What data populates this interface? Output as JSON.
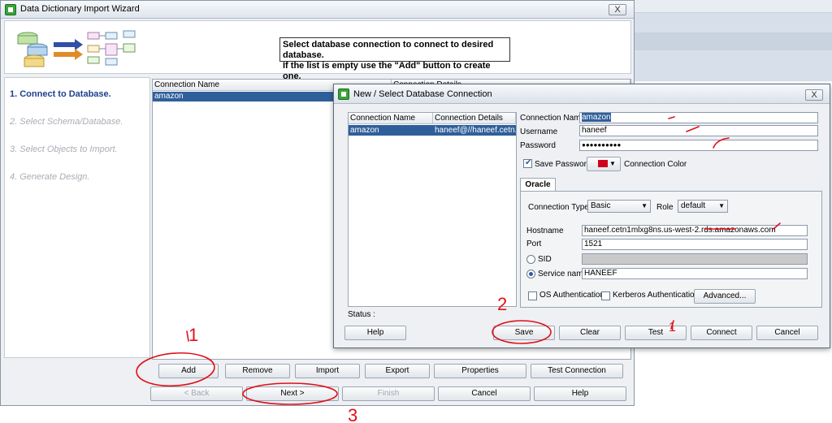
{
  "background_app": {},
  "wizard": {
    "title": "Data Dictionary Import Wizard",
    "close_label": "X",
    "header_message_line1": "Select database connection to connect to desired database.",
    "header_message_line2": "If the list is empty use the \"Add\" button to create one.",
    "steps": [
      {
        "label": "1. Connect to Database."
      },
      {
        "label": "2. Select Schema/Database."
      },
      {
        "label": "3. Select Objects to Import."
      },
      {
        "label": "4. Generate Design."
      }
    ],
    "connection_list": {
      "columns": [
        "Connection Name",
        "Connection Details"
      ],
      "rows": [
        {
          "name": "amazon",
          "details": ""
        }
      ]
    },
    "action_buttons": {
      "add": "Add",
      "remove": "Remove",
      "import": "Import",
      "export": "Export",
      "properties": "Properties",
      "test_connection": "Test Connection"
    },
    "nav_buttons": {
      "back": "< Back",
      "next": "Next >",
      "finish": "Finish",
      "cancel": "Cancel",
      "help": "Help"
    }
  },
  "dialog": {
    "title": "New / Select Database Connection",
    "list": {
      "columns": [
        "Connection Name",
        "Connection Details"
      ],
      "rows": [
        {
          "name": "amazon",
          "details": "haneef@//haneef.cetn..."
        }
      ]
    },
    "fields": {
      "connection_name_label": "Connection Name",
      "connection_name_value": "amazon",
      "username_label": "Username",
      "username_value": "haneef",
      "password_label": "Password",
      "password_value": "●●●●●●●●●●"
    },
    "save_password_label": "Save Password",
    "connection_color_label": "Connection Color",
    "tab_label": "Oracle",
    "connection_type_label": "Connection Type",
    "connection_type_value": "Basic",
    "role_label": "Role",
    "role_value": "default",
    "hostname_label": "Hostname",
    "hostname_value": "haneef.cetn1mlxg8ns.us-west-2.rds.amazonaws.com",
    "port_label": "Port",
    "port_value": "1521",
    "sid_label": "SID",
    "sid_value": "",
    "service_name_label": "Service name",
    "service_name_value": "HANEEF",
    "os_auth_label": "OS Authentication",
    "kerberos_auth_label": "Kerberos Authentication",
    "advanced_label": "Advanced...",
    "status_label": "Status :",
    "buttons": {
      "help": "Help",
      "save": "Save",
      "clear": "Clear",
      "test": "Test",
      "connect": "Connect",
      "cancel": "Cancel"
    },
    "colors": {
      "connection_color": "#d0021b",
      "selection": "#2f5f9a"
    }
  },
  "annotations": {
    "marks": [
      "1",
      "2",
      "3",
      "1"
    ],
    "ink_color": "#e0101a"
  }
}
